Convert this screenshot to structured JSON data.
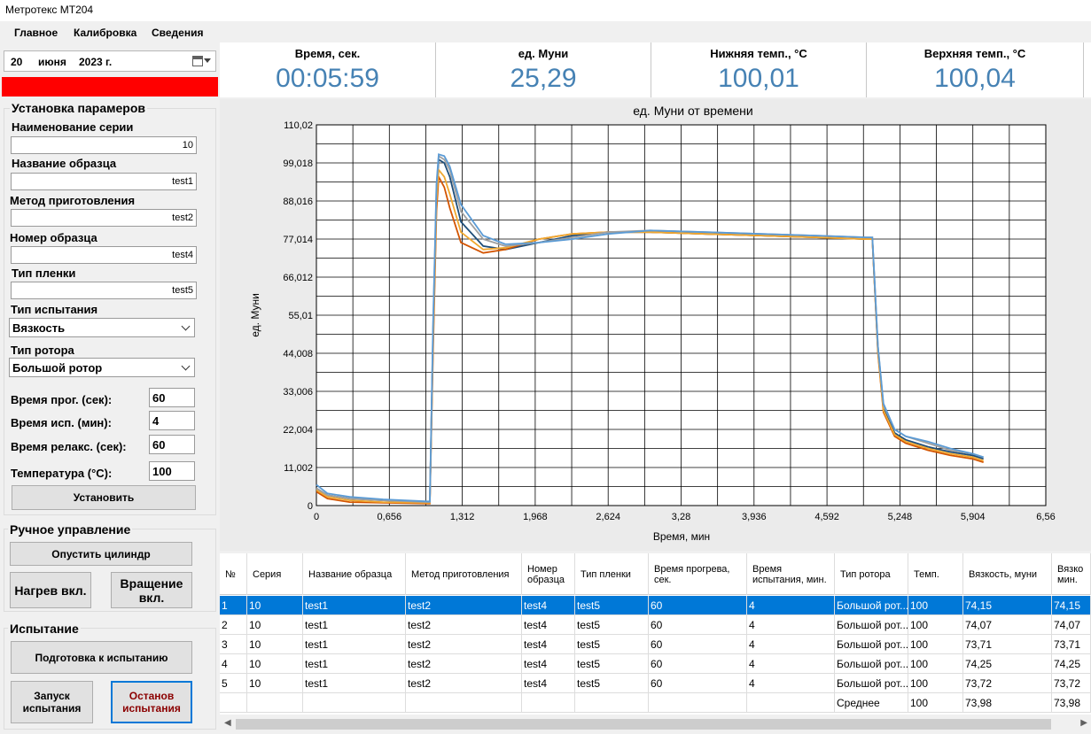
{
  "window": {
    "title": "Метротекс МТ204"
  },
  "menu": [
    "Главное",
    "Калибровка",
    "Сведения"
  ],
  "date": {
    "day": "20",
    "month": "июня",
    "year": "2023 г."
  },
  "settings": {
    "title": "Установка парамеров",
    "series_label": "Наименование серии",
    "series_value": "10",
    "sample_name_label": "Название образца",
    "sample_name_value": "test1",
    "prep_method_label": "Метод приготовления",
    "prep_method_value": "test2",
    "sample_number_label": "Номер образца",
    "sample_number_value": "test4",
    "film_type_label": "Тип пленки",
    "film_type_value": "test5",
    "test_type_label": "Тип испытания",
    "test_type_value": "Вязкость",
    "rotor_type_label": "Тип ротора",
    "rotor_type_value": "Большой ротор",
    "warmup_label": "Время прог. (сек):",
    "warmup_value": "60",
    "test_time_label": "Время исп. (мин):",
    "test_time_value": "4",
    "relax_label": "Время релакс. (сек):",
    "relax_value": "60",
    "temp_label": "Температура (°С):",
    "temp_value": "100",
    "set_button": "Установить"
  },
  "manual": {
    "title": "Ручное управление",
    "lower_cylinder": "Опустить цилиндр",
    "heat_on": "Нагрев вкл.",
    "rotation_on": "Вращение вкл."
  },
  "test": {
    "title": "Испытание",
    "prepare": "Подготовка к испытанию",
    "start": "Запуск испытания",
    "stop": "Останов испытания"
  },
  "metrics": [
    {
      "label": "Время, сек.",
      "value": "00:05:59"
    },
    {
      "label": "ед. Муни",
      "value": "25,29"
    },
    {
      "label": "Нижняя темп., °С",
      "value": "100,01"
    },
    {
      "label": "Верхняя темп., °С",
      "value": "100,04"
    }
  ],
  "chart_data": {
    "type": "line",
    "title": "ед. Муни от времени",
    "xlabel": "Время, мин",
    "ylabel": "ед. Муни",
    "xlim": [
      0,
      6.56
    ],
    "ylim": [
      0,
      110.02
    ],
    "x_ticks": [
      "0",
      "0,656",
      "1,312",
      "1,968",
      "2,624",
      "3,28",
      "3,936",
      "4,592",
      "5,248",
      "5,904",
      "6,56"
    ],
    "y_ticks": [
      "0",
      "11,002",
      "22,004",
      "33,006",
      "44,008",
      "55,01",
      "66,012",
      "77,014",
      "88,016",
      "99,018",
      "110,02"
    ],
    "grid": true,
    "colors": [
      "#1f4e79",
      "#d35400",
      "#f0a830",
      "#a0a0a0",
      "#5b9bd5"
    ],
    "series": [
      {
        "x": [
          0,
          0.1,
          0.3,
          0.6,
          1.0,
          1.02,
          1.05,
          1.08,
          1.1,
          1.15,
          1.2,
          1.3,
          1.5,
          1.7,
          2.0,
          2.3,
          2.624,
          3.0,
          3.5,
          4.0,
          4.5,
          4.95,
          5.0,
          5.05,
          5.1,
          5.2,
          5.3,
          5.5,
          5.7,
          5.9,
          6.0
        ],
        "values": [
          5,
          3,
          2,
          1.5,
          1,
          1,
          50,
          90,
          100,
          99,
          95,
          82,
          75,
          74,
          76,
          78,
          79,
          79,
          78.5,
          78,
          77.5,
          77,
          77,
          45,
          28,
          21,
          19,
          17,
          15.5,
          14.5,
          13.5
        ]
      },
      {
        "x": [
          0,
          0.1,
          0.3,
          0.6,
          1.0,
          1.02,
          1.05,
          1.08,
          1.1,
          1.15,
          1.2,
          1.3,
          1.5,
          1.7,
          2.0,
          2.3,
          2.624,
          3.0,
          3.5,
          4.0,
          4.5,
          4.95,
          5.0,
          5.05,
          5.1,
          5.2,
          5.3,
          5.5,
          5.7,
          5.9,
          6.0
        ],
        "values": [
          4,
          2,
          1,
          0.8,
          0.6,
          0.6,
          45,
          85,
          95,
          92,
          86,
          76,
          73,
          74,
          77,
          78.5,
          79,
          79,
          78.5,
          78,
          77.5,
          77,
          77,
          44,
          27,
          20,
          18,
          16,
          14.5,
          13.5,
          12.5
        ]
      },
      {
        "x": [
          0,
          0.1,
          0.3,
          0.6,
          1.0,
          1.02,
          1.05,
          1.08,
          1.1,
          1.15,
          1.2,
          1.3,
          1.5,
          1.7,
          2.0,
          2.3,
          2.624,
          3.0,
          3.5,
          4.0,
          4.5,
          4.95,
          5.0,
          5.05,
          5.1,
          5.2,
          5.3,
          5.5,
          5.7,
          5.9,
          6.0
        ],
        "values": [
          4.5,
          2.5,
          1.5,
          1,
          0.8,
          0.8,
          48,
          88,
          97,
          95,
          90,
          79,
          74,
          74.5,
          77,
          78.5,
          79,
          79,
          78.5,
          78,
          77.5,
          77,
          77,
          44.5,
          27.5,
          20.5,
          18.5,
          16.5,
          15,
          14,
          13
        ]
      },
      {
        "x": [
          0,
          0.1,
          0.3,
          0.6,
          1.0,
          1.02,
          1.05,
          1.08,
          1.1,
          1.15,
          1.2,
          1.3,
          1.5,
          1.7,
          2.0,
          2.3,
          2.624,
          3.0,
          3.5,
          4.0,
          4.5,
          4.95,
          5.0,
          5.05,
          5.1,
          5.2,
          5.3,
          5.5,
          5.7,
          5.9,
          6.0
        ],
        "values": [
          5,
          3,
          2,
          1.5,
          1,
          1,
          52,
          92,
          101,
          100,
          97,
          85,
          77,
          75,
          76,
          77.5,
          79,
          79.5,
          79,
          78.5,
          78,
          77.5,
          77.5,
          46,
          29,
          22,
          20,
          18,
          16,
          15,
          14
        ]
      },
      {
        "x": [
          0,
          0.1,
          0.3,
          0.6,
          1.0,
          1.02,
          1.05,
          1.08,
          1.1,
          1.15,
          1.2,
          1.3,
          1.5,
          1.7,
          2.0,
          2.3,
          2.624,
          3.0,
          3.5,
          4.0,
          4.5,
          4.95,
          5.0,
          5.05,
          5.1,
          5.2,
          5.3,
          5.5,
          5.7,
          5.9,
          6.0
        ],
        "values": [
          6,
          3.5,
          2.5,
          1.8,
          1.2,
          1.2,
          53,
          93,
          101.5,
          101,
          98,
          87,
          78,
          75.5,
          76,
          77,
          78.5,
          79.5,
          79,
          78.5,
          78,
          77.5,
          77.5,
          46,
          29.5,
          22,
          20,
          18.5,
          16.5,
          15,
          14
        ]
      }
    ]
  },
  "table": {
    "headers": [
      "№",
      "Серия",
      "Название образца",
      "Метод приготовления",
      "Номер образца",
      "Тип пленки",
      "Время прогрева, сек.",
      "Время испытания, мин.",
      "Тип ротора",
      "Темп.",
      "Вязкость, муни",
      "Вязко мин."
    ],
    "rows": [
      [
        "1",
        "10",
        "test1",
        "test2",
        "test4",
        "test5",
        "60",
        "4",
        "Большой рот...",
        "100",
        "74,15",
        "74,15"
      ],
      [
        "2",
        "10",
        "test1",
        "test2",
        "test4",
        "test5",
        "60",
        "4",
        "Большой рот...",
        "100",
        "74,07",
        "74,07"
      ],
      [
        "3",
        "10",
        "test1",
        "test2",
        "test4",
        "test5",
        "60",
        "4",
        "Большой рот...",
        "100",
        "73,71",
        "73,71"
      ],
      [
        "4",
        "10",
        "test1",
        "test2",
        "test4",
        "test5",
        "60",
        "4",
        "Большой рот...",
        "100",
        "74,25",
        "74,25"
      ],
      [
        "5",
        "10",
        "test1",
        "test2",
        "test4",
        "test5",
        "60",
        "4",
        "Большой рот...",
        "100",
        "73,72",
        "73,72"
      ],
      [
        "",
        "",
        "",
        "",
        "",
        "",
        "",
        "",
        "Среднее",
        "100",
        "73,98",
        "73,98"
      ]
    ]
  }
}
